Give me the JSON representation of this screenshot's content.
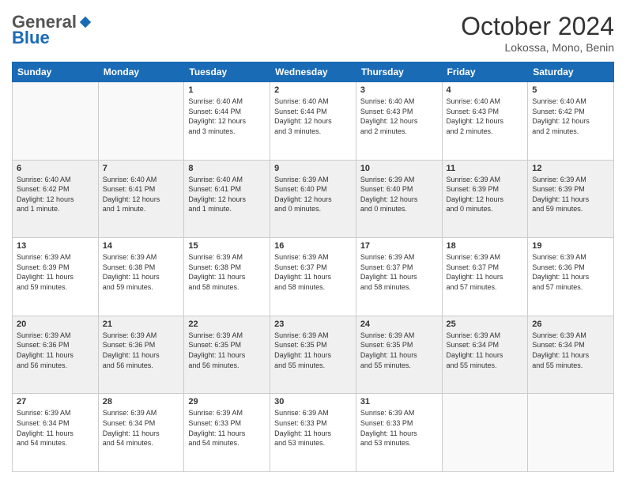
{
  "logo": {
    "general": "General",
    "blue": "Blue"
  },
  "header": {
    "month": "October 2024",
    "location": "Lokossa, Mono, Benin"
  },
  "weekdays": [
    "Sunday",
    "Monday",
    "Tuesday",
    "Wednesday",
    "Thursday",
    "Friday",
    "Saturday"
  ],
  "weeks": [
    [
      {
        "day": "",
        "info": ""
      },
      {
        "day": "",
        "info": ""
      },
      {
        "day": "1",
        "info": "Sunrise: 6:40 AM\nSunset: 6:44 PM\nDaylight: 12 hours\nand 3 minutes."
      },
      {
        "day": "2",
        "info": "Sunrise: 6:40 AM\nSunset: 6:44 PM\nDaylight: 12 hours\nand 3 minutes."
      },
      {
        "day": "3",
        "info": "Sunrise: 6:40 AM\nSunset: 6:43 PM\nDaylight: 12 hours\nand 2 minutes."
      },
      {
        "day": "4",
        "info": "Sunrise: 6:40 AM\nSunset: 6:43 PM\nDaylight: 12 hours\nand 2 minutes."
      },
      {
        "day": "5",
        "info": "Sunrise: 6:40 AM\nSunset: 6:42 PM\nDaylight: 12 hours\nand 2 minutes."
      }
    ],
    [
      {
        "day": "6",
        "info": "Sunrise: 6:40 AM\nSunset: 6:42 PM\nDaylight: 12 hours\nand 1 minute."
      },
      {
        "day": "7",
        "info": "Sunrise: 6:40 AM\nSunset: 6:41 PM\nDaylight: 12 hours\nand 1 minute."
      },
      {
        "day": "8",
        "info": "Sunrise: 6:40 AM\nSunset: 6:41 PM\nDaylight: 12 hours\nand 1 minute."
      },
      {
        "day": "9",
        "info": "Sunrise: 6:39 AM\nSunset: 6:40 PM\nDaylight: 12 hours\nand 0 minutes."
      },
      {
        "day": "10",
        "info": "Sunrise: 6:39 AM\nSunset: 6:40 PM\nDaylight: 12 hours\nand 0 minutes."
      },
      {
        "day": "11",
        "info": "Sunrise: 6:39 AM\nSunset: 6:39 PM\nDaylight: 12 hours\nand 0 minutes."
      },
      {
        "day": "12",
        "info": "Sunrise: 6:39 AM\nSunset: 6:39 PM\nDaylight: 11 hours\nand 59 minutes."
      }
    ],
    [
      {
        "day": "13",
        "info": "Sunrise: 6:39 AM\nSunset: 6:39 PM\nDaylight: 11 hours\nand 59 minutes."
      },
      {
        "day": "14",
        "info": "Sunrise: 6:39 AM\nSunset: 6:38 PM\nDaylight: 11 hours\nand 59 minutes."
      },
      {
        "day": "15",
        "info": "Sunrise: 6:39 AM\nSunset: 6:38 PM\nDaylight: 11 hours\nand 58 minutes."
      },
      {
        "day": "16",
        "info": "Sunrise: 6:39 AM\nSunset: 6:37 PM\nDaylight: 11 hours\nand 58 minutes."
      },
      {
        "day": "17",
        "info": "Sunrise: 6:39 AM\nSunset: 6:37 PM\nDaylight: 11 hours\nand 58 minutes."
      },
      {
        "day": "18",
        "info": "Sunrise: 6:39 AM\nSunset: 6:37 PM\nDaylight: 11 hours\nand 57 minutes."
      },
      {
        "day": "19",
        "info": "Sunrise: 6:39 AM\nSunset: 6:36 PM\nDaylight: 11 hours\nand 57 minutes."
      }
    ],
    [
      {
        "day": "20",
        "info": "Sunrise: 6:39 AM\nSunset: 6:36 PM\nDaylight: 11 hours\nand 56 minutes."
      },
      {
        "day": "21",
        "info": "Sunrise: 6:39 AM\nSunset: 6:36 PM\nDaylight: 11 hours\nand 56 minutes."
      },
      {
        "day": "22",
        "info": "Sunrise: 6:39 AM\nSunset: 6:35 PM\nDaylight: 11 hours\nand 56 minutes."
      },
      {
        "day": "23",
        "info": "Sunrise: 6:39 AM\nSunset: 6:35 PM\nDaylight: 11 hours\nand 55 minutes."
      },
      {
        "day": "24",
        "info": "Sunrise: 6:39 AM\nSunset: 6:35 PM\nDaylight: 11 hours\nand 55 minutes."
      },
      {
        "day": "25",
        "info": "Sunrise: 6:39 AM\nSunset: 6:34 PM\nDaylight: 11 hours\nand 55 minutes."
      },
      {
        "day": "26",
        "info": "Sunrise: 6:39 AM\nSunset: 6:34 PM\nDaylight: 11 hours\nand 55 minutes."
      }
    ],
    [
      {
        "day": "27",
        "info": "Sunrise: 6:39 AM\nSunset: 6:34 PM\nDaylight: 11 hours\nand 54 minutes."
      },
      {
        "day": "28",
        "info": "Sunrise: 6:39 AM\nSunset: 6:34 PM\nDaylight: 11 hours\nand 54 minutes."
      },
      {
        "day": "29",
        "info": "Sunrise: 6:39 AM\nSunset: 6:33 PM\nDaylight: 11 hours\nand 54 minutes."
      },
      {
        "day": "30",
        "info": "Sunrise: 6:39 AM\nSunset: 6:33 PM\nDaylight: 11 hours\nand 53 minutes."
      },
      {
        "day": "31",
        "info": "Sunrise: 6:39 AM\nSunset: 6:33 PM\nDaylight: 11 hours\nand 53 minutes."
      },
      {
        "day": "",
        "info": ""
      },
      {
        "day": "",
        "info": ""
      }
    ]
  ],
  "colors": {
    "header_bg": "#1a6bb5",
    "shaded_row": "#f0f0f0",
    "white_row": "#ffffff"
  }
}
